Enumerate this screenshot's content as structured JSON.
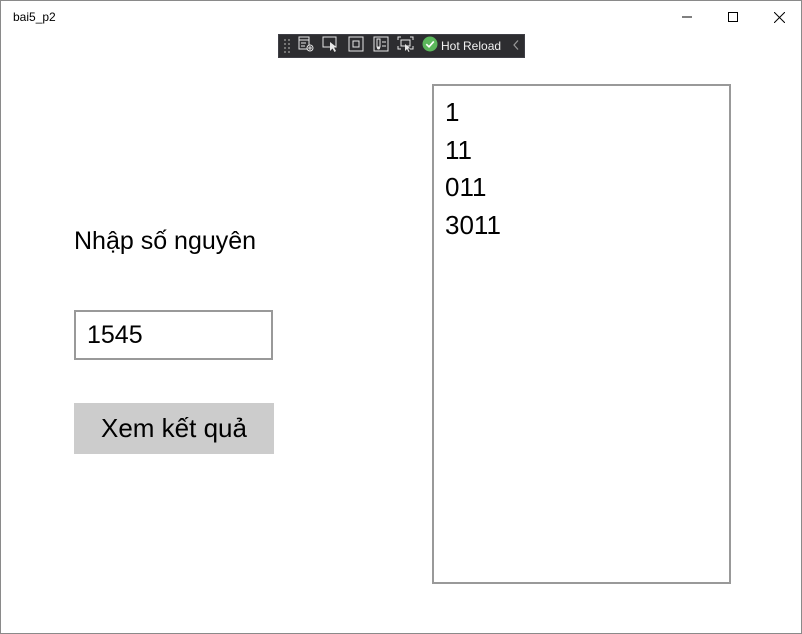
{
  "window": {
    "title": "bai5_p2",
    "controls": {
      "minimize_icon": "minimize-icon",
      "maximize_icon": "maximize-icon",
      "close_icon": "close-icon"
    }
  },
  "devtools_toolbar": {
    "icons": [
      "live-visual-tree-icon",
      "select-element-icon",
      "display-layout-adorners-icon",
      "track-focus-icon",
      "binding-failures-icon"
    ],
    "hot_reload_label": "Hot Reload",
    "hot_reload_status_color": "#5bb75b",
    "background_color": "#2d2d30"
  },
  "form": {
    "prompt_label": "Nhập số nguyên",
    "input_value": "1545",
    "submit_label": "Xem kết quả",
    "button_color": "#cccccc"
  },
  "results": {
    "lines": [
      "1",
      "11",
      "011",
      "3011"
    ]
  }
}
